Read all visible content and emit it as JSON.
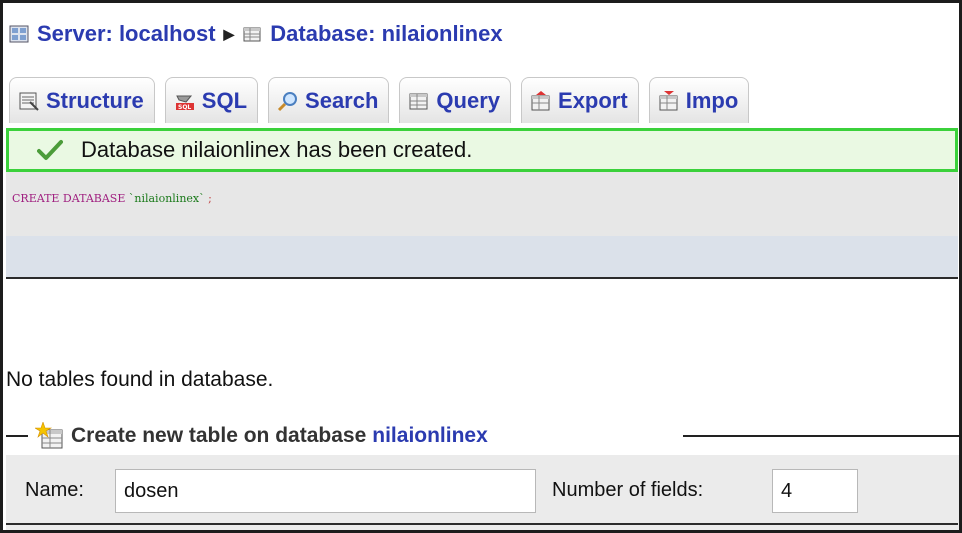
{
  "breadcrumb": {
    "server_label": "Server: localhost",
    "database_label": "Database: nilaionlinex"
  },
  "tabs": [
    {
      "label": "Structure",
      "icon": "structure-icon"
    },
    {
      "label": "SQL",
      "icon": "sql-icon"
    },
    {
      "label": "Search",
      "icon": "search-icon"
    },
    {
      "label": "Query",
      "icon": "query-icon"
    },
    {
      "label": "Export",
      "icon": "export-icon"
    },
    {
      "label": "Impo",
      "icon": "import-icon"
    }
  ],
  "message": {
    "text": "Database nilaionlinex has been created.",
    "icon": "check-icon",
    "border_color": "#3bd13b"
  },
  "sql": {
    "keyword": "CREATE DATABASE",
    "identifier": "`nilaionlinex`",
    "terminator": ";"
  },
  "empty_notice": "No tables found in database.",
  "create_table": {
    "legend_prefix": "Create new table on database",
    "database": "nilaionlinex",
    "name_label": "Name:",
    "name_value": "dosen",
    "fields_label": "Number of fields:",
    "fields_value": "4"
  },
  "colors": {
    "link": "#2b3bb0",
    "success_bg": "#eaf9e3"
  }
}
